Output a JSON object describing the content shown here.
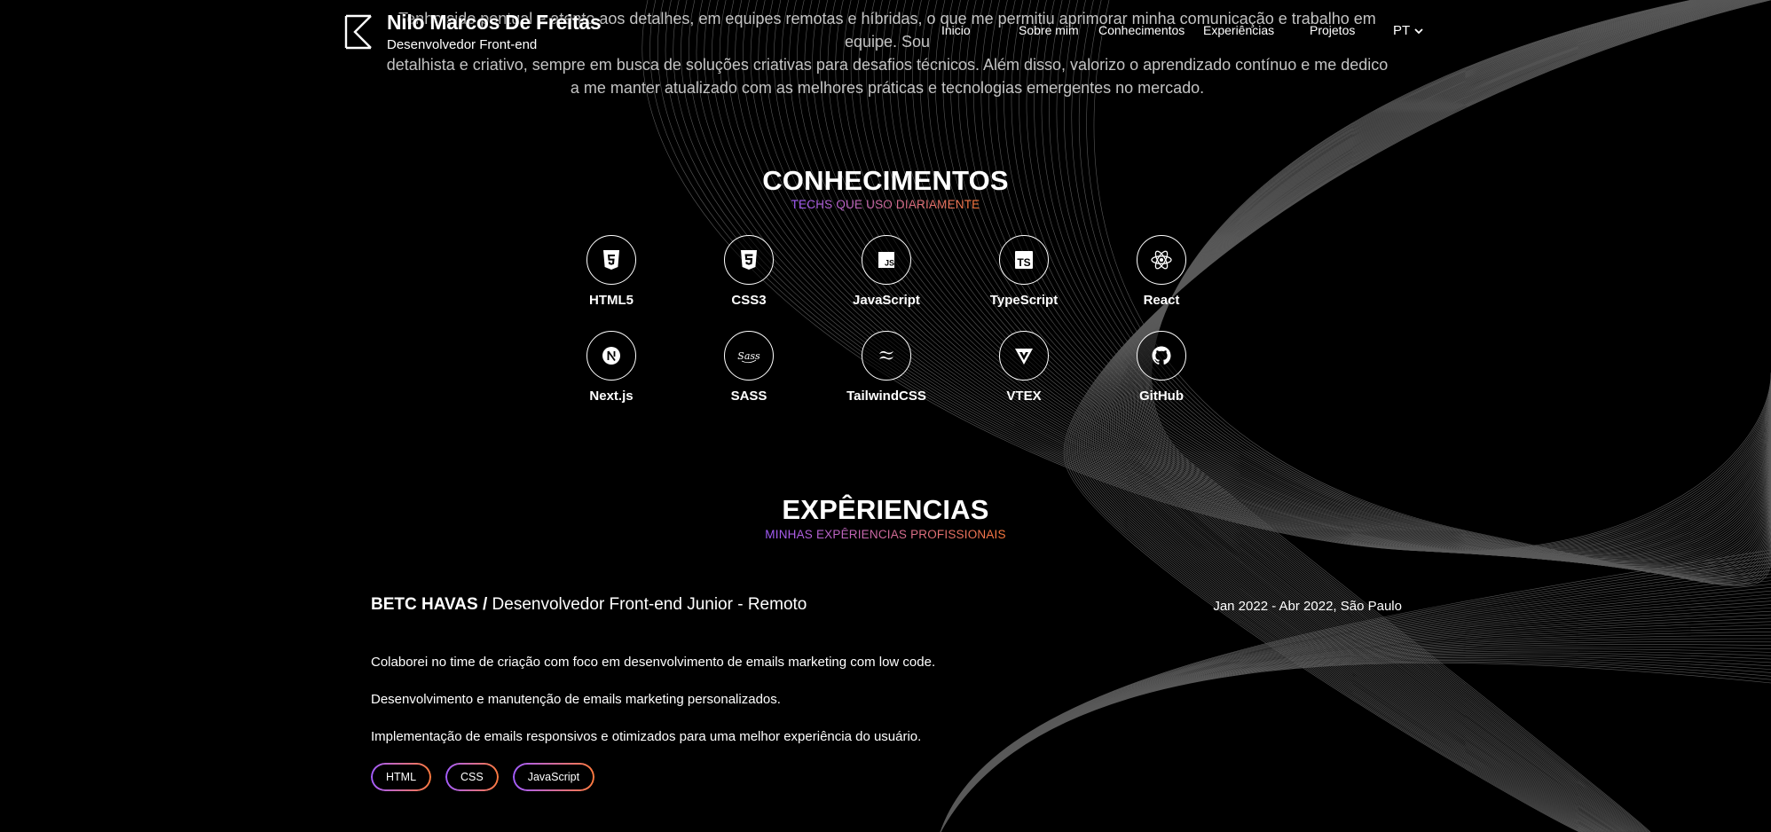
{
  "intro": {
    "lines": [
      "Tenho sido pontual e atento aos detalhes, em equipes remotas e híbridas, o que me permitiu aprimorar minha comunicação e trabalho em equipe. Sou",
      "detalhista e criativo, sempre em busca de soluções criativas para desafios técnicos. Além disso, valorizo o aprendizado contínuo e me dedico",
      "a me manter atualizado com as melhores práticas e tecnologias emergentes no mercado."
    ]
  },
  "header": {
    "name": "Nilo Marcos De Freitas",
    "role": "Desenvolvedor Front-end",
    "nav": [
      "Inicio",
      "Sobre mim",
      "Conhecimentos",
      "Experiências",
      "Projetos"
    ],
    "language": "PT"
  },
  "skills_section": {
    "title": "CONHECIMENTOS",
    "subtitle": "TECHS QUE USO DIARIAMENTE",
    "items": [
      {
        "label": "HTML5",
        "icon": "html5-icon"
      },
      {
        "label": "CSS3",
        "icon": "css3-icon"
      },
      {
        "label": "JavaScript",
        "icon": "javascript-icon"
      },
      {
        "label": "TypeScript",
        "icon": "typescript-icon"
      },
      {
        "label": "React",
        "icon": "react-icon"
      },
      {
        "label": "Next.js",
        "icon": "nextjs-icon"
      },
      {
        "label": "SASS",
        "icon": "sass-icon"
      },
      {
        "label": "TailwindCSS",
        "icon": "tailwind-icon"
      },
      {
        "label": "VTEX",
        "icon": "vtex-icon"
      },
      {
        "label": "GitHub",
        "icon": "github-icon"
      }
    ]
  },
  "experience_section": {
    "title": "EXPÊRIENCIAS",
    "subtitle": "MINHAS EXPÊRIENCIAS PROFISSIONAIS",
    "jobs": [
      {
        "company": "BETC HAVAS /",
        "position": "Desenvolvedor Front-end Junior - Remoto",
        "period": "Jan 2022 - Abr 2022, São Paulo",
        "bullets": [
          "Colaborei no time de criação com foco em desenvolvimento de emails marketing com low code.",
          "Desenvolvimento e manutenção de emails marketing personalizados.",
          "Implementação de emails responsivos e otimizados para uma melhor experiência do usuário."
        ],
        "tags": [
          "HTML",
          "CSS",
          "JavaScript"
        ]
      }
    ]
  },
  "colors": {
    "background": "#000000",
    "gradient_start": "#a35cff",
    "gradient_end": "#ff7a3d"
  }
}
